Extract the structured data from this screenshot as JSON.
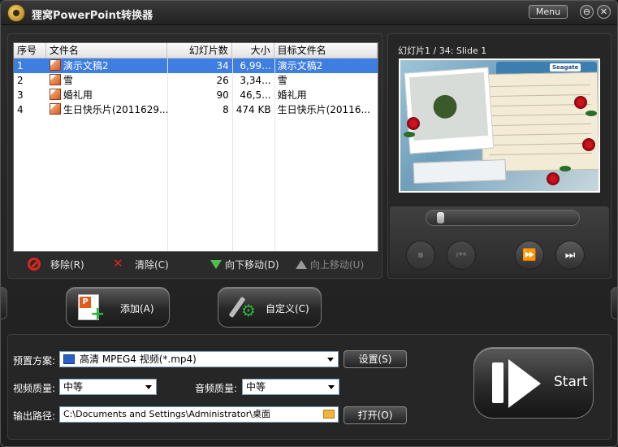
{
  "app": {
    "title": "狸窝PowerPoint转换器",
    "menu_label": "Menu",
    "minimize_label": "⊖",
    "close_label": "✕"
  },
  "file_table": {
    "columns": [
      "序号",
      "文件名",
      "幻灯片数",
      "大小",
      "目标文件名"
    ],
    "rows": [
      {
        "index": "1",
        "name": "演示文稿2",
        "slides": "34",
        "size": "6,99...",
        "target": "演示文稿2",
        "selected": true
      },
      {
        "index": "2",
        "name": "雪",
        "slides": "26",
        "size": "3,34...",
        "target": "雪",
        "selected": false
      },
      {
        "index": "3",
        "name": "婚礼用",
        "slides": "90",
        "size": "46,5...",
        "target": "婚礼用",
        "selected": false
      },
      {
        "index": "4",
        "name": "生日快乐片(2011629...",
        "slides": "8",
        "size": "474 KB",
        "target": "生日快乐片(20116...",
        "selected": false
      }
    ]
  },
  "list_actions": {
    "remove_label": "移除(R)",
    "clear_label": "清除(C)",
    "move_down_label": "向下移动(D)",
    "move_up_label": "向上移动(U)"
  },
  "preview": {
    "title": "幻灯片1 / 34: Slide 1",
    "slide_brand": "Seagate",
    "seek_position": 0.05,
    "buttons": {
      "stop_icon": "⏹",
      "rewind_icon": "⏮",
      "forward_icon": "⏩",
      "next_icon": "⏭"
    }
  },
  "buttons": {
    "add_label": "添加(A)",
    "customize_label": "自定义(C)",
    "settings_label": "设置(S)",
    "open_label": "打开(O)",
    "start_label": "Start"
  },
  "settings": {
    "preset_label": "预置方案:",
    "preset_value": "高清 MPEG4 视频(*.mp4)",
    "video_quality_label": "视频质量:",
    "video_quality_value": "中等",
    "audio_quality_label": "音频质量:",
    "audio_quality_value": "中等",
    "output_path_label": "输出路径:",
    "output_path_value": "C:\\Documents and Settings\\Administrator\\桌面"
  },
  "colors": {
    "selection": "#3d7ee0",
    "background": "#1e1e1e",
    "accent_green": "#4cc246",
    "remove_red": "#e0241c"
  }
}
